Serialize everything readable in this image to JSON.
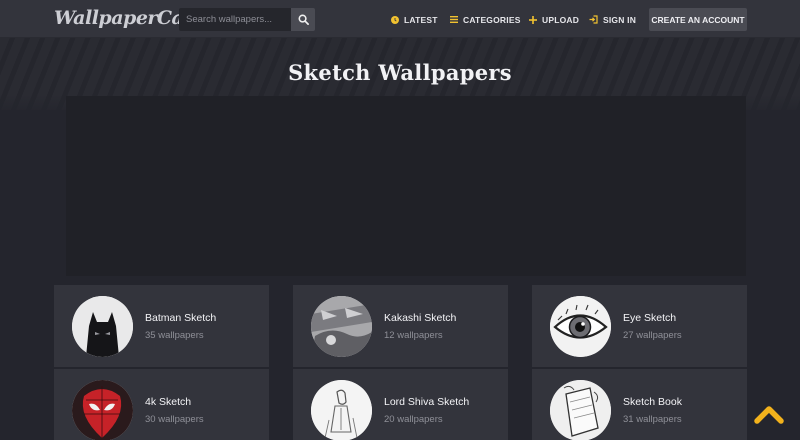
{
  "brand": {
    "logo": "WallpaperCave"
  },
  "search": {
    "placeholder": "Search wallpapers..."
  },
  "nav": {
    "latest": "LATEST",
    "categories": "CATEGORIES",
    "upload": "UPLOAD",
    "sign_in": "SIGN IN",
    "create_account": "CREATE AN ACCOUNT"
  },
  "page": {
    "title": "Sketch Wallpapers"
  },
  "cards": [
    {
      "title": "Batman Sketch",
      "count": "35 wallpapers",
      "icon": "batman-thumbnail"
    },
    {
      "title": "Kakashi Sketch",
      "count": "12 wallpapers",
      "icon": "kakashi-thumbnail"
    },
    {
      "title": "Eye Sketch",
      "count": "27 wallpapers",
      "icon": "eye-thumbnail"
    },
    {
      "title": "4k Sketch",
      "count": "30 wallpapers",
      "icon": "spiderman-thumbnail"
    },
    {
      "title": "Lord Shiva Sketch",
      "count": "20 wallpapers",
      "icon": "shiva-thumbnail"
    },
    {
      "title": "Sketch Book",
      "count": "31 wallpapers",
      "icon": "sketchbook-thumbnail"
    }
  ],
  "colors": {
    "navbar": "#33343c",
    "background": "#24252d",
    "card": "#33343c",
    "accent_yellow": "#f2b21c"
  }
}
